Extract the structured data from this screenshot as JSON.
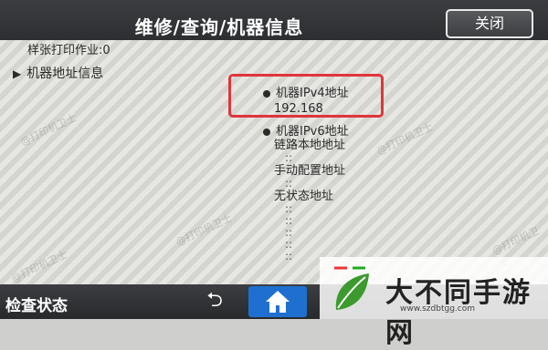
{
  "header": {
    "title": "维修/查询/机器信息",
    "close_label": "关闭"
  },
  "content": {
    "partial_row": "样张打印作业:0",
    "section_label": "机器地址信息",
    "ipv4_label": "机器IPv4地址",
    "ipv4_value": "192.168",
    "ipv6_label": "机器IPv6地址",
    "link_local": "链路本地地址",
    "manual_config": "手动配置地址",
    "stateless": "无状态地址",
    "dots": "::"
  },
  "bottom_bar": {
    "status_label": "检查状态",
    "back_icon": "back-arrow-icon",
    "home_icon": "home-icon"
  },
  "watermark": {
    "site_text": "大不同手游网",
    "url": "www.szdbtgg.com"
  },
  "colors": {
    "highlight": "#e0353a",
    "home_active": "#1f6fd0",
    "header_bg": "#2f3134"
  }
}
